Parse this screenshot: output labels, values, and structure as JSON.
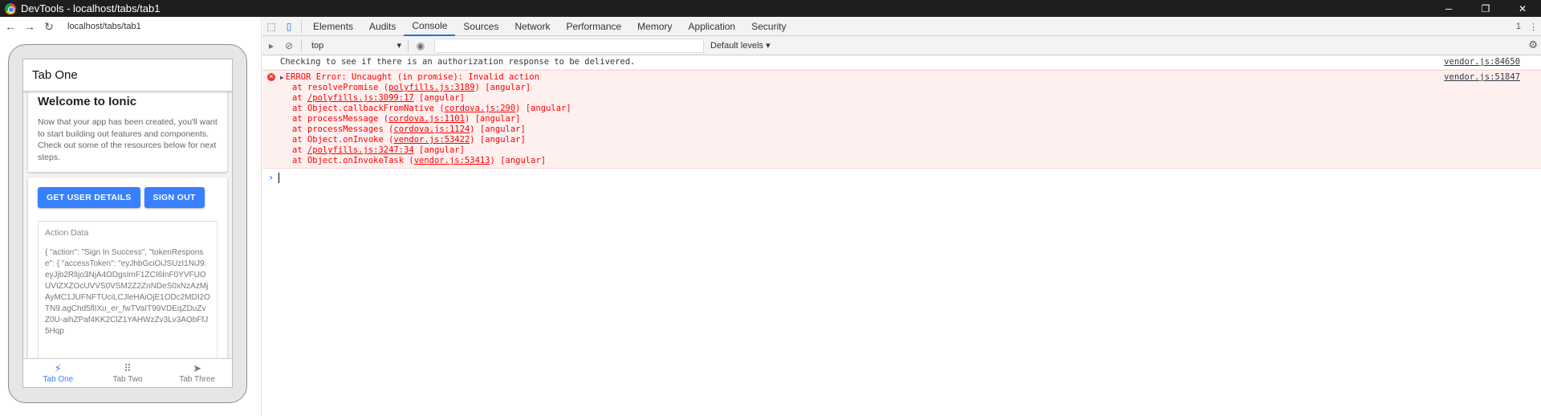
{
  "window": {
    "title": "DevTools - localhost/tabs/tab1",
    "controls": {
      "minimize": "─",
      "restore": "❐",
      "close": "✕"
    }
  },
  "device": {
    "url": "localhost/tabs/tab1",
    "header_title": "Tab One",
    "welcome": {
      "title": "Welcome to Ionic",
      "body": "Now that your app has been created, you'll want to start building out features and components. Check out some of the resources below for next steps."
    },
    "buttons": {
      "get_user_details": "GET USER DETAILS",
      "sign_out": "SIGN OUT"
    },
    "action_data": {
      "label": "Action Data",
      "json": "{ \"action\": \"Sign In Success\", \"tokenResponse\": { \"accessToken\": \"eyJhbGciOiJSUzI1NiJ9.eyJjb2RlIjo3NjA4ODgsImF1ZCI6InF0YVFUOUVIZXZOcUVVS0VSM2Z2ZnNDeS0xNzAzMjAyMC1JUFNFTUciLCJleHAiOjE1ODc2MDI2OTN9.agChd5flIXu_er_fwTVaIT99VDEqZDuZvZ0U-aihZPaf4KK2ClZ1YAHWzZv3Lv3AObFfJ5Hqp"
    },
    "tabs": [
      {
        "label": "Tab One",
        "icon": "flash-icon",
        "active": true
      },
      {
        "label": "Tab Two",
        "icon": "apps-icon",
        "active": false
      },
      {
        "label": "Tab Three",
        "icon": "send-icon",
        "active": false
      }
    ]
  },
  "devtools": {
    "tabs": [
      "Elements",
      "Audits",
      "Console",
      "Sources",
      "Network",
      "Performance",
      "Memory",
      "Application",
      "Security"
    ],
    "active_tab": "Console",
    "error_count": "1",
    "console_toolbar": {
      "context": "top",
      "levels": "Default levels ▾"
    },
    "messages": {
      "info": {
        "text": "Checking to see if there is an authorization response to be delivered.",
        "source": "vendor.js:84650"
      },
      "error": {
        "headline": "ERROR Error: Uncaught (in promise): Invalid action",
        "source": "vendor.js:51847",
        "stack": [
          {
            "pre": "at resolvePromise (",
            "link": "polyfills.js:3189",
            "post": ") [angular]"
          },
          {
            "pre": "at ",
            "link": "/polyfills.js:3099:17",
            "post": " [angular]"
          },
          {
            "pre": "at Object.callbackFromNative (",
            "link": "cordova.js:290",
            "post": ") [angular]"
          },
          {
            "pre": "at processMessage (",
            "link": "cordova.js:1101",
            "post": ") [angular]"
          },
          {
            "pre": "at processMessages (",
            "link": "cordova.js:1124",
            "post": ") [angular]"
          },
          {
            "pre": "at Object.onInvoke (",
            "link": "vendor.js:53422",
            "post": ") [angular]"
          },
          {
            "pre": "at ",
            "link": "/polyfills.js:3247:34",
            "post": " [angular]"
          },
          {
            "pre": "at Object.onInvokeTask (",
            "link": "vendor.js:53413",
            "post": ") [angular]"
          }
        ]
      }
    }
  }
}
